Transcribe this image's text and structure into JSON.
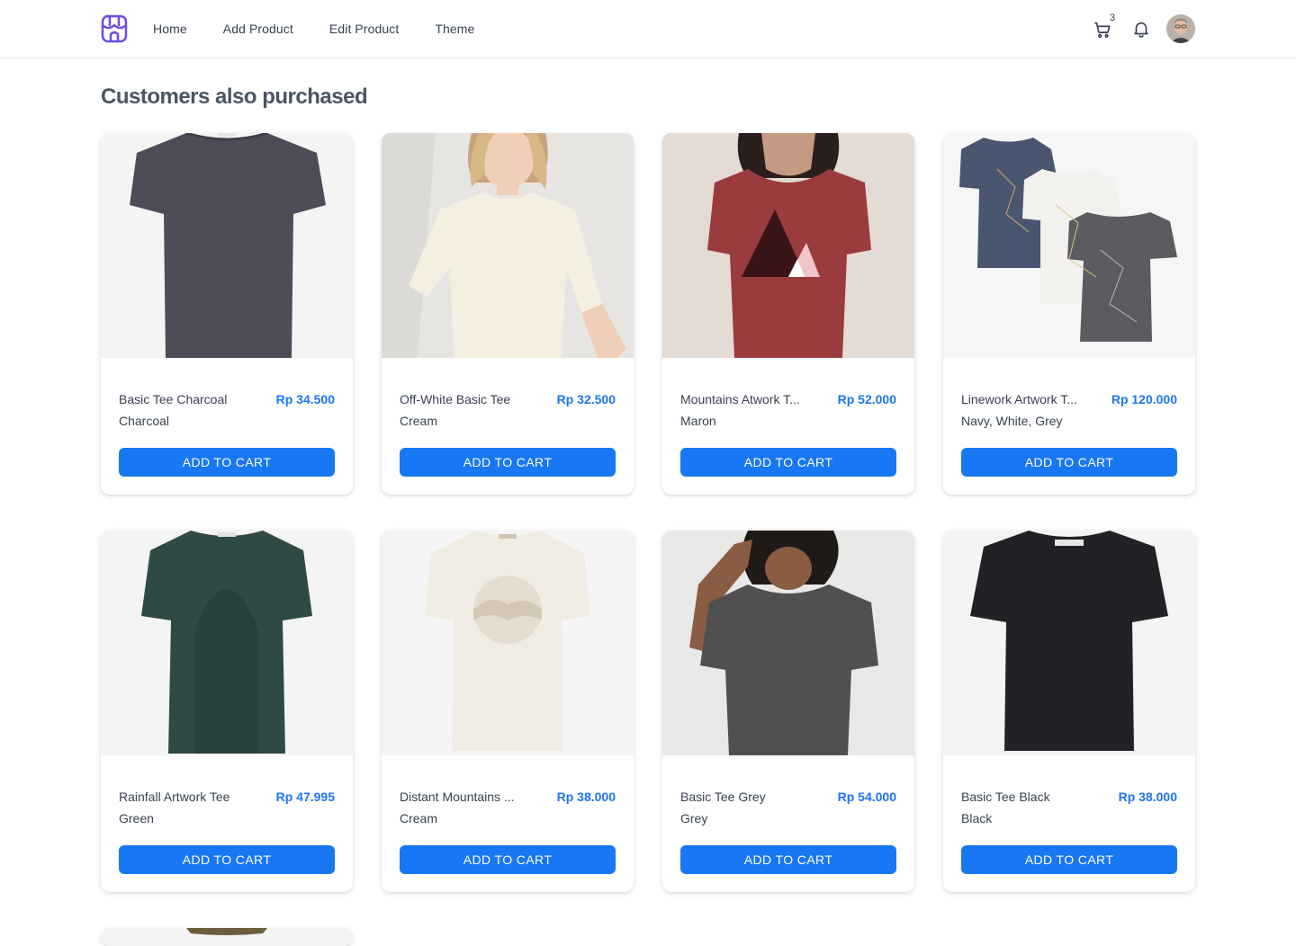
{
  "nav": {
    "items": [
      {
        "label": "Home"
      },
      {
        "label": "Add Product"
      },
      {
        "label": "Edit Product"
      },
      {
        "label": "Theme"
      }
    ],
    "cart_count": "3",
    "logo_icon": "store-icon",
    "cart_icon": "cart-icon",
    "bell_icon": "bell-icon"
  },
  "section": {
    "title": "Customers also purchased"
  },
  "colors": {
    "accent": "#1877f2",
    "price": "#1d74f5"
  },
  "products": [
    {
      "name": "Basic Tee Charcoal",
      "price": "Rp 34.500",
      "color": "Charcoal",
      "button": "ADD TO CART"
    },
    {
      "name": "Off-White Basic Tee",
      "price": "Rp 32.500",
      "color": "Cream",
      "button": "ADD TO CART"
    },
    {
      "name": "Mountains Atwork T...",
      "price": "Rp 52.000",
      "color": "Maron",
      "button": "ADD TO CART"
    },
    {
      "name": "Linework Artwork T...",
      "price": "Rp 120.000",
      "color": "Navy, White, Grey",
      "button": "ADD TO CART"
    },
    {
      "name": "Rainfall Artwork Tee",
      "price": "Rp 47.995",
      "color": "Green",
      "button": "ADD TO CART"
    },
    {
      "name": "Distant Mountains ...",
      "price": "Rp 38.000",
      "color": "Cream",
      "button": "ADD TO CART"
    },
    {
      "name": "Basic Tee Grey",
      "price": "Rp 54.000",
      "color": "Grey",
      "button": "ADD TO CART"
    },
    {
      "name": "Basic Tee Black",
      "price": "Rp 38.000",
      "color": "Black",
      "button": "ADD TO CART"
    }
  ]
}
